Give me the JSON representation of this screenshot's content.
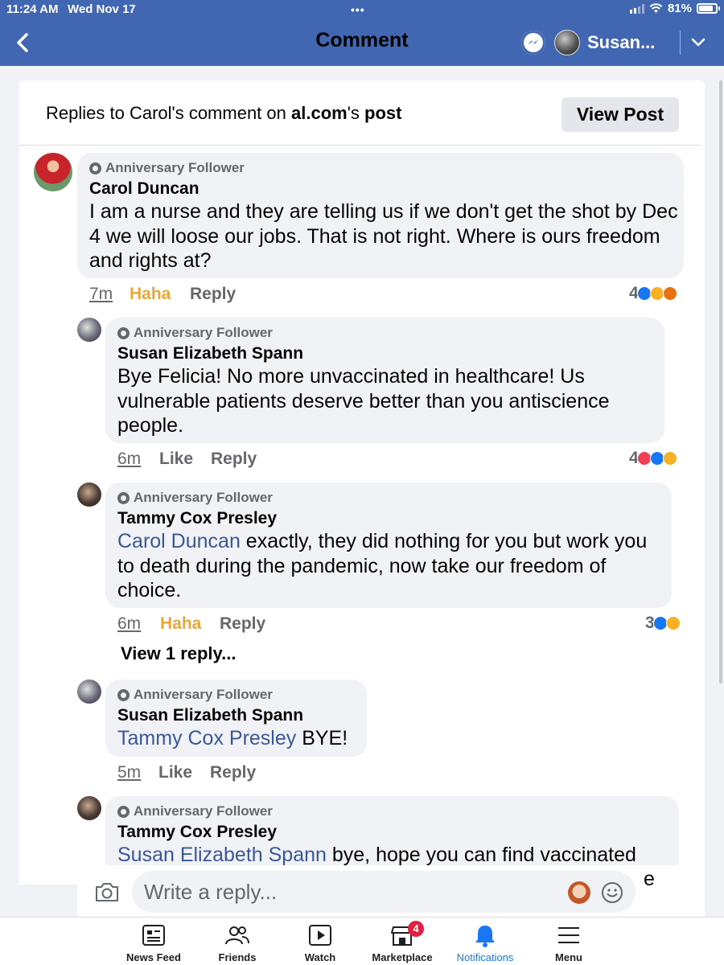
{
  "status_bar": {
    "time": "11:24 AM",
    "date": "Wed Nov 17",
    "battery": "81%"
  },
  "nav": {
    "title": "Comment",
    "username": "Susan..."
  },
  "header": {
    "prefix": "Replies to Carol's comment on ",
    "page": "al.com",
    "suffix": "'s ",
    "post_word": "post",
    "view_post_label": "View Post"
  },
  "comments": [
    {
      "badge": "Anniversary Follower",
      "author": "Carol Duncan",
      "text": "I am a nurse and they are telling us if we don't get the shot by Dec 4 we will loose our jobs. That is not right. Where is ours freedom and rights at?",
      "time": "7m",
      "reaction_action": "Haha",
      "reply_label": "Reply",
      "reaction_count": "4",
      "reaction_types": [
        "like",
        "haha",
        "angry"
      ]
    },
    {
      "badge": "Anniversary Follower",
      "author": "Susan Elizabeth Spann",
      "text": "Bye Felicia! No more unvaccinated in healthcare! Us vulnerable patients deserve better than you antiscience people.",
      "time": "6m",
      "reaction_action": "Like",
      "reply_label": "Reply",
      "reaction_count": "4",
      "reaction_types": [
        "love",
        "like",
        "haha"
      ]
    },
    {
      "badge": "Anniversary Follower",
      "author": "Tammy Cox Presley",
      "mention": "Carol Duncan",
      "text": " exactly, they did nothing for you but work you to death during the pandemic, now take our freedom of choice.",
      "time": "6m",
      "reaction_action": "Haha",
      "reply_label": "Reply",
      "reaction_count": "3",
      "reaction_types": [
        "like",
        "haha"
      ]
    },
    {
      "badge": "Anniversary Follower",
      "author": "Susan Elizabeth Spann",
      "mention": "Tammy Cox Presley",
      "text": " BYE!",
      "time": "5m",
      "reaction_action": "Like",
      "reply_label": "Reply"
    },
    {
      "badge": "Anniversary Follower",
      "author": "Tammy Cox Presley",
      "mention": "Susan Elizabeth Spann",
      "text": " bye, hope you can find vaccinated",
      "overflow_fragment": "e"
    }
  ],
  "view_replies_label": "View 1 reply...",
  "composer": {
    "placeholder": "Write a reply..."
  },
  "tabs": [
    {
      "label": "News Feed",
      "icon": "news-feed-icon"
    },
    {
      "label": "Friends",
      "icon": "friends-icon"
    },
    {
      "label": "Watch",
      "icon": "watch-icon"
    },
    {
      "label": "Marketplace",
      "icon": "marketplace-icon",
      "badge": "4"
    },
    {
      "label": "Notifications",
      "icon": "bell-icon",
      "active": true
    },
    {
      "label": "Menu",
      "icon": "menu-icon"
    }
  ],
  "colors": {
    "nav_blue": "#4267b2",
    "link_blue": "#385898",
    "haha_orange": "#e7a73a",
    "active_tab": "#1877f2",
    "badge_red": "#e41e3f"
  }
}
